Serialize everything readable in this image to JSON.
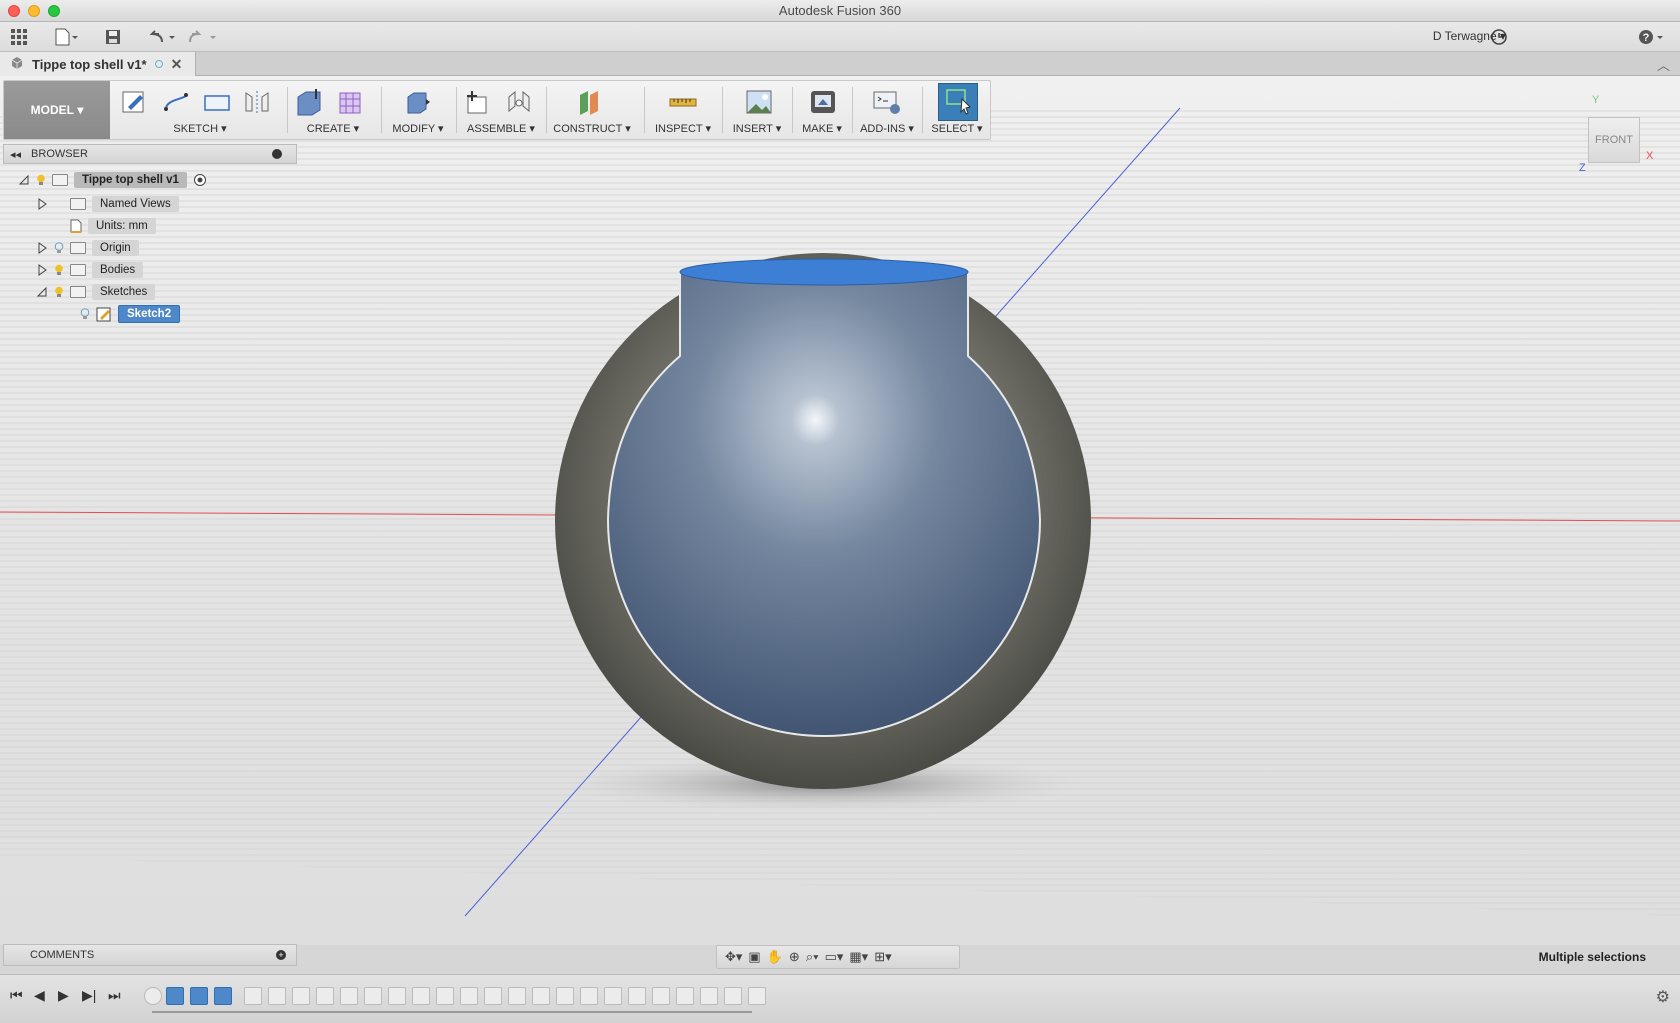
{
  "app": {
    "window_title": "Autodesk Fusion 360"
  },
  "quick_access": {
    "user_name": "D Terwagne",
    "help_label": "?"
  },
  "document_tab": {
    "title": "Tippe top shell v1*",
    "close_glyph": "✕"
  },
  "ribbon": {
    "workspace": "MODEL",
    "groups": [
      {
        "label": "SKETCH"
      },
      {
        "label": "CREATE"
      },
      {
        "label": "MODIFY"
      },
      {
        "label": "ASSEMBLE"
      },
      {
        "label": "CONSTRUCT"
      },
      {
        "label": "INSPECT"
      },
      {
        "label": "INSERT"
      },
      {
        "label": "MAKE"
      },
      {
        "label": "ADD-INS"
      },
      {
        "label": "SELECT"
      }
    ]
  },
  "browser": {
    "header": "BROWSER",
    "items": [
      {
        "label": "Tippe top shell v1"
      },
      {
        "label": "Named Views"
      },
      {
        "label": "Units: mm"
      },
      {
        "label": "Origin"
      },
      {
        "label": "Bodies"
      },
      {
        "label": "Sketches"
      },
      {
        "label": "Sketch2"
      }
    ]
  },
  "viewcube": {
    "face": "FRONT",
    "axis_y": "Y",
    "axis_x": "X",
    "axis_z": "Z"
  },
  "comments": {
    "label": "COMMENTS"
  },
  "status": {
    "selection": "Multiple selections"
  },
  "colors": {
    "accent": "#4e88c8",
    "x_axis": "#e05050",
    "z_axis": "#4a5fd8",
    "shell": "#6a6a62",
    "inner": "#5b6f8c"
  },
  "icons": {
    "grid_menu": "grid-icon",
    "file": "file-icon",
    "save": "save-icon",
    "undo": "undo-icon",
    "redo": "redo-icon",
    "history": "clock-icon",
    "settings": "gear-icon"
  }
}
